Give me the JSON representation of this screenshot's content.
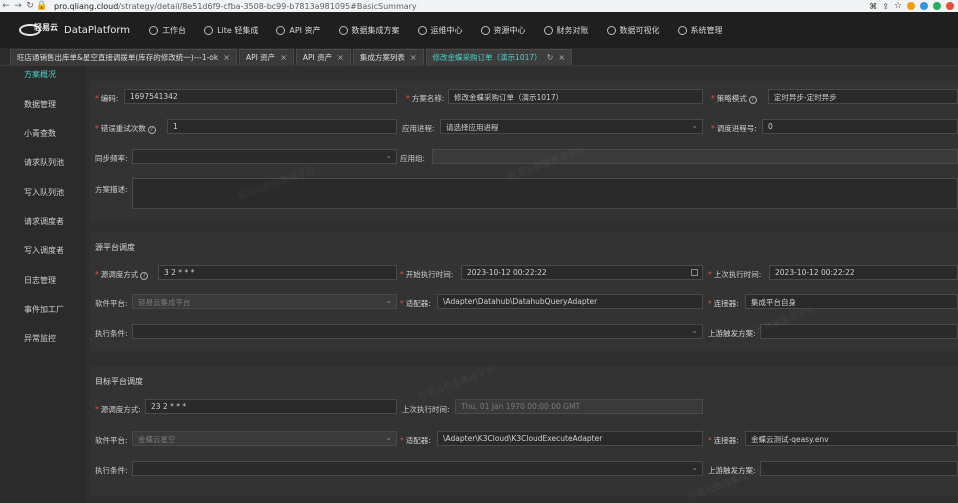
{
  "browser": {
    "url_host": "pro.qliang.cloud",
    "url_path": "/strategy/detail/8e51d6f9-cfba-3508-bc99-b7813a981095#BasicSummary"
  },
  "topnav": {
    "brand": "DataPlatform",
    "items": [
      {
        "label": "工作台",
        "icon": "clock-icon"
      },
      {
        "label": "Lite 轻集成",
        "icon": "cube-icon"
      },
      {
        "label": "API 资产",
        "icon": "api-icon"
      },
      {
        "label": "数据集成方案",
        "icon": "flow-icon"
      },
      {
        "label": "运维中心",
        "icon": "wrench-icon"
      },
      {
        "label": "资源中心",
        "icon": "resource-icon"
      },
      {
        "label": "财务对账",
        "icon": "ledger-icon"
      },
      {
        "label": "数据可视化",
        "icon": "chart-icon"
      },
      {
        "label": "系统管理",
        "icon": "settings-icon"
      }
    ]
  },
  "tabs": [
    {
      "label": "旺店通销售出库单&星空直接调拨单(库存的修改统一)---1-ok"
    },
    {
      "label": "API 资产"
    },
    {
      "label": "API 资产"
    },
    {
      "label": "集成方案列表"
    },
    {
      "label": "修改金蝶采购订单（演示1017）",
      "active": true
    }
  ],
  "sidebar": {
    "items": [
      "方案概况",
      "数据管理",
      "小青查数",
      "请求队列池",
      "写入队列池",
      "请求调度者",
      "写入调度者",
      "日志管理",
      "事件加工厂",
      "异常监控"
    ]
  },
  "form": {
    "code_label": "编码:",
    "code_value": "1697541342",
    "scheme_label": "方案名称:",
    "scheme_value": "修改金蝶采购订单（演示1017）",
    "strategy_label": "策略模式",
    "strategy_value": "定时异步-定时异步",
    "retry_label": "错误重试次数",
    "retry_value": "1",
    "app_proc_label": "应用进程:",
    "app_proc_placeholder": "请选择应用进程",
    "sched_proc_label": "调度进程号:",
    "sched_proc_value": "0",
    "sync_freq_label": "同步频率:",
    "app_group_label": "应用组:",
    "desc_label": "方案描述:"
  },
  "source": {
    "title": "源平台调度",
    "mode_label": "源调度方式",
    "mode_value": "3 2 * * *",
    "start_label": "开始执行时间:",
    "start_value": "2023-10-12 00:22:22",
    "last_label": "上次执行时间:",
    "last_value": "2023-10-12 00:22:22",
    "platform_label": "软件平台:",
    "platform_value": "轻易云集成平台",
    "adapter_label": "适配器:",
    "adapter_value": "\\Adapter\\Datahub\\DatahubQueryAdapter",
    "connector_label": "连接器:",
    "connector_value": "集成平台自身",
    "cond_label": "执行条件:",
    "upstream_label": "上游触发方案:"
  },
  "target": {
    "title": "目标平台调度",
    "mode_label": "源调度方式:",
    "mode_value": "23 2 * * *",
    "last_label": "上次执行时间:",
    "last_placeholder": "Thu, 01 Jan 1970 00:00:00 GMT",
    "platform_label": "软件平台:",
    "platform_value": "金蝶云星空",
    "adapter_label": "适配器:",
    "adapter_value": "\\Adapter\\K3Cloud\\K3CloudExecuteAdapter",
    "connector_label": "连接器:",
    "connector_value": "金蝶云测试-qeasy.env",
    "cond_label": "执行条件:",
    "upstream_label": "上游触发方案:"
  },
  "watermark": "轻易云数据集成平台"
}
